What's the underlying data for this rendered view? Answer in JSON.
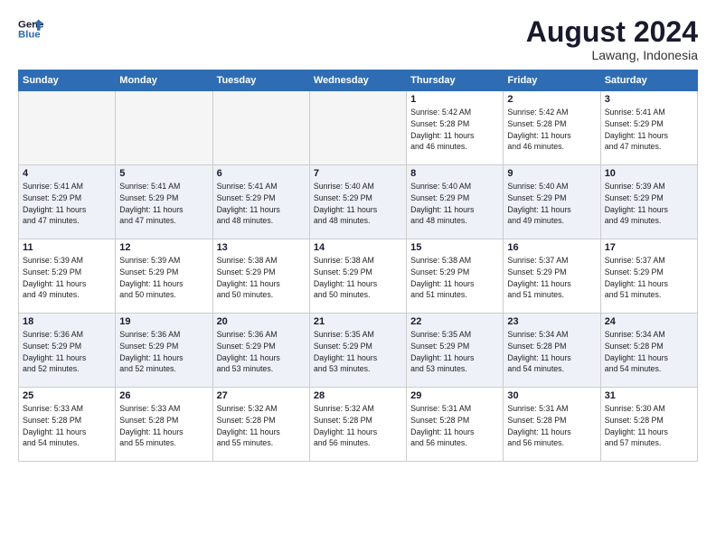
{
  "header": {
    "logo_line1": "General",
    "logo_line2": "Blue",
    "month_year": "August 2024",
    "location": "Lawang, Indonesia"
  },
  "weekdays": [
    "Sunday",
    "Monday",
    "Tuesday",
    "Wednesday",
    "Thursday",
    "Friday",
    "Saturday"
  ],
  "weeks": [
    [
      {
        "day": "",
        "info": ""
      },
      {
        "day": "",
        "info": ""
      },
      {
        "day": "",
        "info": ""
      },
      {
        "day": "",
        "info": ""
      },
      {
        "day": "1",
        "info": "Sunrise: 5:42 AM\nSunset: 5:28 PM\nDaylight: 11 hours\nand 46 minutes."
      },
      {
        "day": "2",
        "info": "Sunrise: 5:42 AM\nSunset: 5:28 PM\nDaylight: 11 hours\nand 46 minutes."
      },
      {
        "day": "3",
        "info": "Sunrise: 5:41 AM\nSunset: 5:29 PM\nDaylight: 11 hours\nand 47 minutes."
      }
    ],
    [
      {
        "day": "4",
        "info": "Sunrise: 5:41 AM\nSunset: 5:29 PM\nDaylight: 11 hours\nand 47 minutes."
      },
      {
        "day": "5",
        "info": "Sunrise: 5:41 AM\nSunset: 5:29 PM\nDaylight: 11 hours\nand 47 minutes."
      },
      {
        "day": "6",
        "info": "Sunrise: 5:41 AM\nSunset: 5:29 PM\nDaylight: 11 hours\nand 48 minutes."
      },
      {
        "day": "7",
        "info": "Sunrise: 5:40 AM\nSunset: 5:29 PM\nDaylight: 11 hours\nand 48 minutes."
      },
      {
        "day": "8",
        "info": "Sunrise: 5:40 AM\nSunset: 5:29 PM\nDaylight: 11 hours\nand 48 minutes."
      },
      {
        "day": "9",
        "info": "Sunrise: 5:40 AM\nSunset: 5:29 PM\nDaylight: 11 hours\nand 49 minutes."
      },
      {
        "day": "10",
        "info": "Sunrise: 5:39 AM\nSunset: 5:29 PM\nDaylight: 11 hours\nand 49 minutes."
      }
    ],
    [
      {
        "day": "11",
        "info": "Sunrise: 5:39 AM\nSunset: 5:29 PM\nDaylight: 11 hours\nand 49 minutes."
      },
      {
        "day": "12",
        "info": "Sunrise: 5:39 AM\nSunset: 5:29 PM\nDaylight: 11 hours\nand 50 minutes."
      },
      {
        "day": "13",
        "info": "Sunrise: 5:38 AM\nSunset: 5:29 PM\nDaylight: 11 hours\nand 50 minutes."
      },
      {
        "day": "14",
        "info": "Sunrise: 5:38 AM\nSunset: 5:29 PM\nDaylight: 11 hours\nand 50 minutes."
      },
      {
        "day": "15",
        "info": "Sunrise: 5:38 AM\nSunset: 5:29 PM\nDaylight: 11 hours\nand 51 minutes."
      },
      {
        "day": "16",
        "info": "Sunrise: 5:37 AM\nSunset: 5:29 PM\nDaylight: 11 hours\nand 51 minutes."
      },
      {
        "day": "17",
        "info": "Sunrise: 5:37 AM\nSunset: 5:29 PM\nDaylight: 11 hours\nand 51 minutes."
      }
    ],
    [
      {
        "day": "18",
        "info": "Sunrise: 5:36 AM\nSunset: 5:29 PM\nDaylight: 11 hours\nand 52 minutes."
      },
      {
        "day": "19",
        "info": "Sunrise: 5:36 AM\nSunset: 5:29 PM\nDaylight: 11 hours\nand 52 minutes."
      },
      {
        "day": "20",
        "info": "Sunrise: 5:36 AM\nSunset: 5:29 PM\nDaylight: 11 hours\nand 53 minutes."
      },
      {
        "day": "21",
        "info": "Sunrise: 5:35 AM\nSunset: 5:29 PM\nDaylight: 11 hours\nand 53 minutes."
      },
      {
        "day": "22",
        "info": "Sunrise: 5:35 AM\nSunset: 5:29 PM\nDaylight: 11 hours\nand 53 minutes."
      },
      {
        "day": "23",
        "info": "Sunrise: 5:34 AM\nSunset: 5:28 PM\nDaylight: 11 hours\nand 54 minutes."
      },
      {
        "day": "24",
        "info": "Sunrise: 5:34 AM\nSunset: 5:28 PM\nDaylight: 11 hours\nand 54 minutes."
      }
    ],
    [
      {
        "day": "25",
        "info": "Sunrise: 5:33 AM\nSunset: 5:28 PM\nDaylight: 11 hours\nand 54 minutes."
      },
      {
        "day": "26",
        "info": "Sunrise: 5:33 AM\nSunset: 5:28 PM\nDaylight: 11 hours\nand 55 minutes."
      },
      {
        "day": "27",
        "info": "Sunrise: 5:32 AM\nSunset: 5:28 PM\nDaylight: 11 hours\nand 55 minutes."
      },
      {
        "day": "28",
        "info": "Sunrise: 5:32 AM\nSunset: 5:28 PM\nDaylight: 11 hours\nand 56 minutes."
      },
      {
        "day": "29",
        "info": "Sunrise: 5:31 AM\nSunset: 5:28 PM\nDaylight: 11 hours\nand 56 minutes."
      },
      {
        "day": "30",
        "info": "Sunrise: 5:31 AM\nSunset: 5:28 PM\nDaylight: 11 hours\nand 56 minutes."
      },
      {
        "day": "31",
        "info": "Sunrise: 5:30 AM\nSunset: 5:28 PM\nDaylight: 11 hours\nand 57 minutes."
      }
    ]
  ]
}
